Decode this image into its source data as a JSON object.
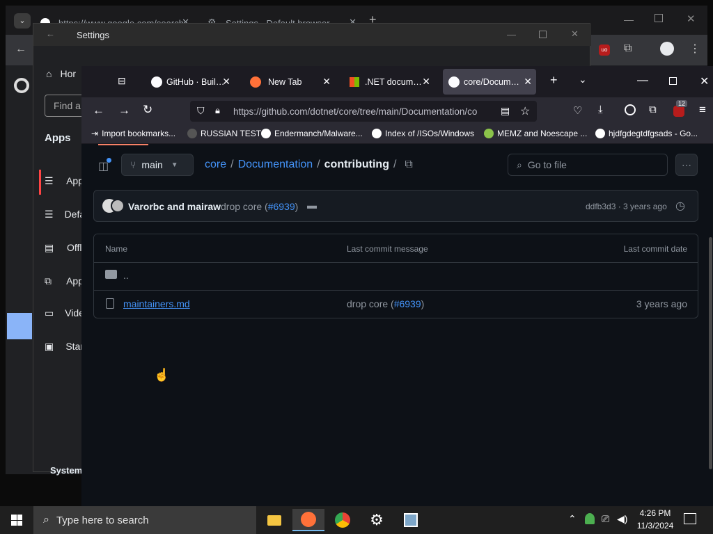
{
  "chrome": {
    "tab1_title": "https://www.google.com/search",
    "tab2_title": "Settings - Default browser"
  },
  "settings": {
    "title": "Settings",
    "find_placeholder": "Find a",
    "home": "Hor",
    "apps_heading": "Apps",
    "items": [
      "App",
      "Defa",
      "Offl",
      "App",
      "Vide",
      "Star"
    ],
    "system": "System"
  },
  "firefox": {
    "tabs": [
      {
        "title": "GitHub · Build a"
      },
      {
        "title": "New Tab"
      },
      {
        "title": ".NET document"
      },
      {
        "title": "core/Document"
      }
    ],
    "url": "https://github.com/dotnet/core/tree/main/Documentation/co",
    "extension_badge": "12",
    "bookmarks": [
      {
        "label": "Import bookmarks...",
        "color": "#fbfbfe"
      },
      {
        "label": "RUSSIAN TEST",
        "color": "#555"
      },
      {
        "label": "Endermanch/Malware...",
        "color": "#fff"
      },
      {
        "label": "Index of /ISOs/Windows",
        "color": "#fff"
      },
      {
        "label": "MEMZ and Noescape ...",
        "color": "#8bc34a"
      },
      {
        "label": "hjdfgdegtdfgsads - Go...",
        "color": "#fff"
      }
    ]
  },
  "github": {
    "branch": "main",
    "breadcrumb": {
      "repo": "core",
      "sep1": "/",
      "folder": "Documentation",
      "sep2": "/",
      "current": "contributing",
      "sep3": "/"
    },
    "go_to_file": "Go to file",
    "commit": {
      "authors": "Varorbc and mairaw",
      "message": "drop core (",
      "pr": "#6939",
      "message_end": ")",
      "sha_time": "ddfb3d3 · 3 years ago"
    },
    "table": {
      "headers": {
        "name": "Name",
        "message": "Last commit message",
        "date": "Last commit date"
      },
      "parent": "..",
      "rows": [
        {
          "name": "maintainers.md",
          "message": "drop core (",
          "pr": "#6939",
          "message_end": ")",
          "date": "3 years ago"
        }
      ]
    }
  },
  "taskbar": {
    "search_placeholder": "Type here to search",
    "time": "4:26 PM",
    "date": "11/3/2024"
  }
}
